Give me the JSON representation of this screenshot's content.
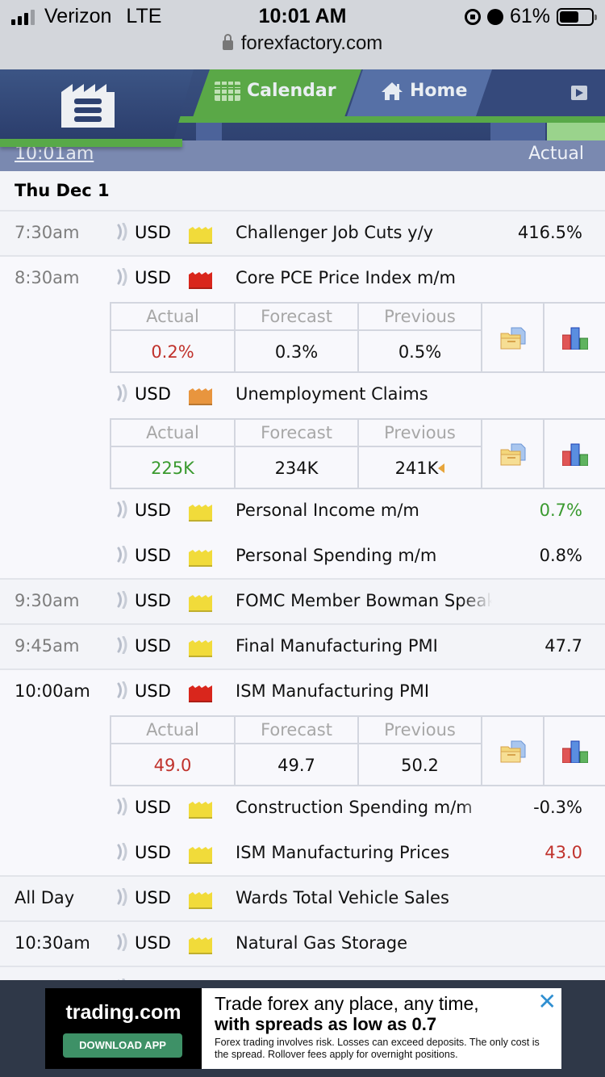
{
  "status_bar": {
    "carrier": "Verizon",
    "network": "LTE",
    "time": "10:01 AM",
    "battery_percent": "61%",
    "battery_level": 0.61
  },
  "browser": {
    "url": "forexfactory.com"
  },
  "header": {
    "menu_icon": "factory-menu-icon",
    "tabs": [
      {
        "label": "Calendar",
        "icon": "calendar-icon",
        "active": true
      },
      {
        "label": "Home",
        "icon": "home-icon",
        "active": false
      }
    ],
    "login_icon": "login-icon"
  },
  "timebar": {
    "current_time": "10:01am",
    "column_label": "Actual"
  },
  "calendar": {
    "day": "Thu Dec 1",
    "detail_headers": {
      "actual": "Actual",
      "forecast": "Forecast",
      "previous": "Previous"
    },
    "impact_colors": {
      "low": "#f1db3a",
      "medium": "#e8953e",
      "high": "#d9261c"
    },
    "value_colors": {
      "better": "#3a9a2f",
      "worse": "#c0322c"
    },
    "events": [
      {
        "time": "7:30am",
        "currency": "USD",
        "impact": "low",
        "name": "Challenger Job Cuts y/y",
        "actual": "416.5%",
        "actual_color": "neutral"
      },
      {
        "time": "8:30am",
        "currency": "USD",
        "impact": "high",
        "name": "Core PCE Price Index m/m",
        "detail": {
          "actual": "0.2%",
          "actual_color": "worse",
          "forecast": "0.3%",
          "previous": "0.5%",
          "revised": false
        }
      },
      {
        "time": "",
        "currency": "USD",
        "impact": "medium",
        "name": "Unemployment Claims",
        "detail": {
          "actual": "225K",
          "actual_color": "better",
          "forecast": "234K",
          "previous": "241K",
          "revised": true
        }
      },
      {
        "time": "",
        "currency": "USD",
        "impact": "low",
        "name": "Personal Income m/m",
        "actual": "0.7%",
        "actual_color": "better"
      },
      {
        "time": "",
        "currency": "USD",
        "impact": "low",
        "name": "Personal Spending m/m",
        "actual": "0.8%",
        "actual_color": "neutral"
      },
      {
        "time": "9:30am",
        "currency": "USD",
        "impact": "low",
        "name": "FOMC Member Bowman Speaks",
        "actual": ""
      },
      {
        "time": "9:45am",
        "currency": "USD",
        "impact": "low",
        "name": "Final Manufacturing PMI",
        "actual": "47.7",
        "actual_color": "neutral"
      },
      {
        "time": "10:00am",
        "currency": "USD",
        "impact": "high",
        "name": "ISM Manufacturing PMI",
        "detail": {
          "actual": "49.0",
          "actual_color": "worse",
          "forecast": "49.7",
          "previous": "50.2",
          "revised": false
        }
      },
      {
        "time": "",
        "currency": "USD",
        "impact": "low",
        "name": "Construction Spending m/m",
        "actual": "-0.3%",
        "actual_color": "neutral"
      },
      {
        "time": "",
        "currency": "USD",
        "impact": "low",
        "name": "ISM Manufacturing Prices",
        "actual": "43.0",
        "actual_color": "worse"
      },
      {
        "time": "All Day",
        "currency": "USD",
        "impact": "low",
        "name": "Wards Total Vehicle Sales",
        "actual": ""
      },
      {
        "time": "10:30am",
        "currency": "USD",
        "impact": "low",
        "name": "Natural Gas Storage",
        "actual": ""
      }
    ]
  },
  "ad": {
    "brand": "trading.com",
    "cta": "DOWNLOAD APP",
    "headline": "Trade forex any place, any time,",
    "subheadline": "with spreads as low as 0.7",
    "disclaimer": "Forex trading involves risk. Losses can exceed deposits. The only cost is the spread. Rollover fees apply for  overnight positions.",
    "close_label": "✕"
  }
}
